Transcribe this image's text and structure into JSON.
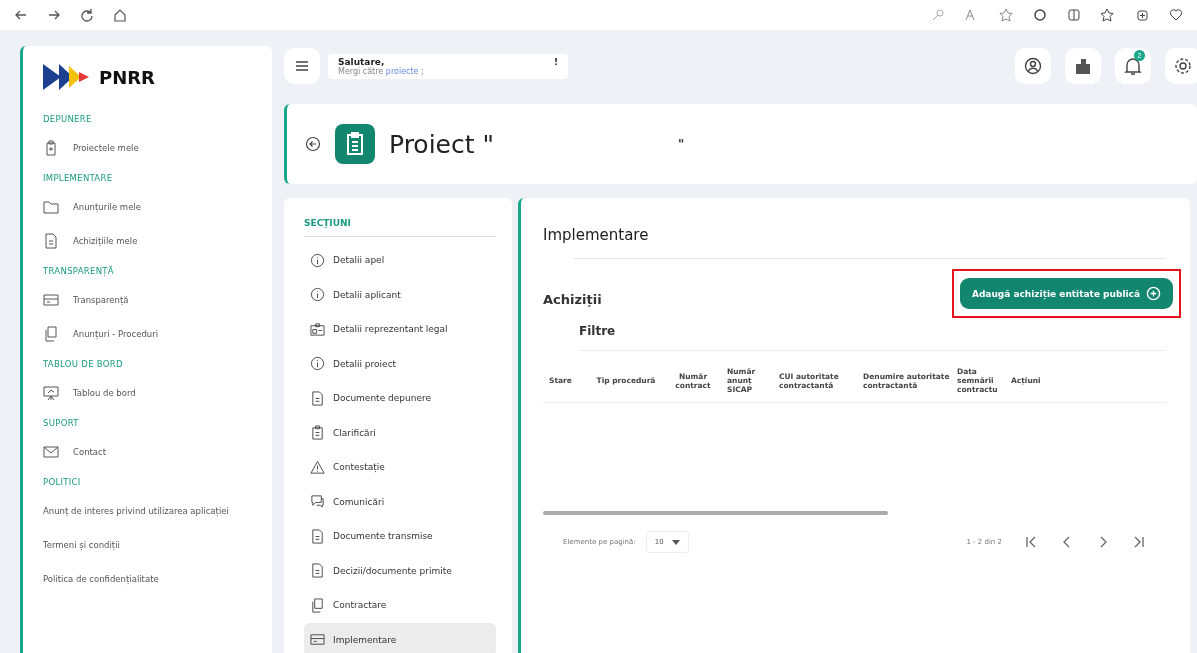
{
  "sidebar": {
    "logo": "PNRR",
    "groups": [
      {
        "title": "DEPUNERE",
        "items": [
          {
            "label": "Proiectele mele",
            "kind": "clipboard"
          }
        ]
      },
      {
        "title": "IMPLEMENTARE",
        "items": [
          {
            "label": "Anunțurile mele",
            "kind": "folder"
          },
          {
            "label": "Achizițiile mele",
            "kind": "doc"
          }
        ]
      },
      {
        "title": "TRANSPARENȚĂ",
        "items": [
          {
            "label": "Transparență",
            "kind": "card"
          },
          {
            "label": "Anunțuri - Proceduri",
            "kind": "copy"
          }
        ]
      },
      {
        "title": "TABLOU DE BORD",
        "items": [
          {
            "label": "Tablou de bord",
            "kind": "board"
          }
        ]
      },
      {
        "title": "SUPORT",
        "items": [
          {
            "label": "Contact",
            "kind": "mail"
          }
        ]
      },
      {
        "title": "POLITICI",
        "items": [
          {
            "label": "Anunț de interes privind utilizarea aplicației",
            "kind": "link"
          },
          {
            "label": "Termeni și condiții",
            "kind": "link"
          },
          {
            "label": "Politica de confidențialitate",
            "kind": "link"
          }
        ]
      }
    ]
  },
  "header": {
    "greeting": "Salutare,",
    "greeting_end": "!",
    "subtitle": "Mergi către",
    "subtitle_link": "proiecte",
    "subtitle_end": ";",
    "notification_count": "2"
  },
  "project": {
    "title": "Proiect \"",
    "title_end": "\""
  },
  "sections": {
    "title": "SECȚIUNI",
    "items": [
      {
        "label": "Detalii apel",
        "kind": "info",
        "selected": false
      },
      {
        "label": "Detalii aplicant",
        "kind": "info",
        "selected": false
      },
      {
        "label": "Detalii reprezentant legal",
        "kind": "id",
        "selected": false
      },
      {
        "label": "Detalii proiect",
        "kind": "info",
        "selected": false
      },
      {
        "label": "Documente depunere",
        "kind": "doc",
        "selected": false
      },
      {
        "label": "Clarificări",
        "kind": "clipboard",
        "selected": false
      },
      {
        "label": "Contestație",
        "kind": "warning",
        "selected": false
      },
      {
        "label": "Comunicări",
        "kind": "chat",
        "selected": false
      },
      {
        "label": "Documente transmise",
        "kind": "doc",
        "selected": false
      },
      {
        "label": "Decizii/documente primite",
        "kind": "doc",
        "selected": false
      },
      {
        "label": "Contractare",
        "kind": "copy",
        "selected": false
      },
      {
        "label": "Implementare",
        "kind": "card",
        "selected": true
      }
    ]
  },
  "content": {
    "title": "Implementare",
    "subtitle": "Achiziții",
    "add_button": {
      "label": "Adaugă achiziție entitate publică",
      "highlighted": true
    },
    "filters": "Filtre",
    "table": {
      "columns": [
        "Stare",
        "Tip procedură",
        "Număr contract",
        "Număr anunț SICAP",
        "CUI autoritate contractantă",
        "Denumire autoritate contractantă",
        "Data semnării contractu",
        "Acțiuni"
      ]
    },
    "pagination": {
      "per_page_label": "Elemente pe pagină:",
      "per_page": "10",
      "range": "1 - 2 din 2"
    }
  }
}
